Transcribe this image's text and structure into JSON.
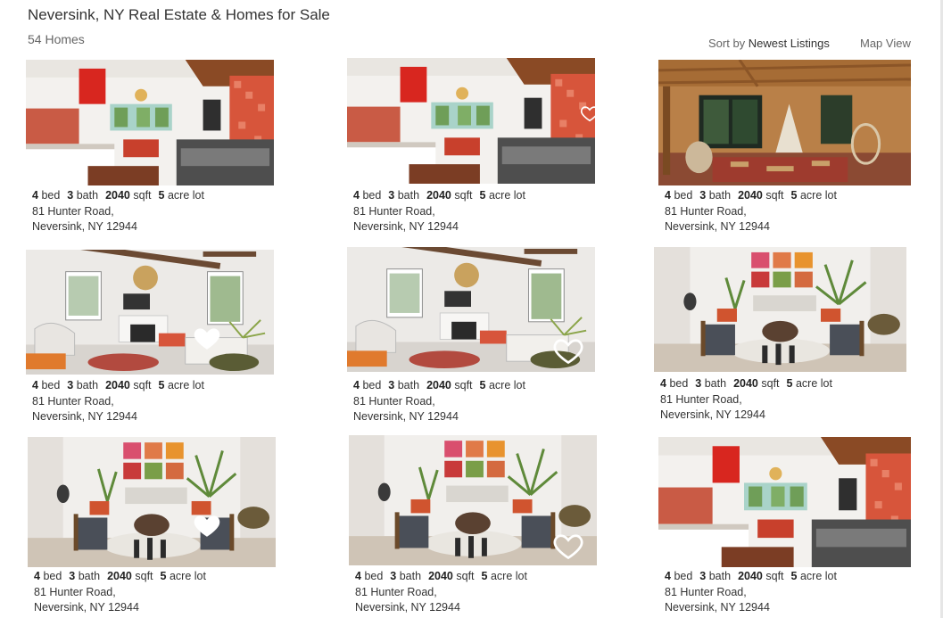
{
  "header": {
    "title": "Neversink, NY Real Estate & Homes for Sale",
    "count": "54 Homes",
    "sort_prefix": "Sort by ",
    "sort_value": "Newest Listings",
    "map_view": "Map View"
  },
  "listings": [
    {
      "beds": "4",
      "beds_unit": "bed",
      "baths": "3",
      "baths_unit": "bath",
      "sqft": "2040",
      "sqft_unit": "sqft",
      "lot": "5",
      "lot_unit": "acre lot",
      "address1": "81 Hunter Road,",
      "address2": "Neversink, NY 12944",
      "photo": "kitchen",
      "heart": "none"
    },
    {
      "beds": "4",
      "beds_unit": "bed",
      "baths": "3",
      "baths_unit": "bath",
      "sqft": "2040",
      "sqft_unit": "sqft",
      "lot": "5",
      "lot_unit": "acre lot",
      "address1": "81 Hunter Road,",
      "address2": "Neversink, NY 12944",
      "photo": "kitchen",
      "heart": "partial"
    },
    {
      "beds": "4",
      "beds_unit": "bed",
      "baths": "3",
      "baths_unit": "bath",
      "sqft": "2040",
      "sqft_unit": "sqft",
      "lot": "5",
      "lot_unit": "acre lot",
      "address1": "81 Hunter Road,",
      "address2": "Neversink, NY 12944",
      "photo": "wood-porch",
      "heart": "none"
    },
    {
      "beds": "4",
      "beds_unit": "bed",
      "baths": "3",
      "baths_unit": "bath",
      "sqft": "2040",
      "sqft_unit": "sqft",
      "lot": "5",
      "lot_unit": "acre lot",
      "address1": "81 Hunter Road,",
      "address2": "Neversink, NY 12944",
      "photo": "living-room",
      "heart": "filled"
    },
    {
      "beds": "4",
      "beds_unit": "bed",
      "baths": "3",
      "baths_unit": "bath",
      "sqft": "2040",
      "sqft_unit": "sqft",
      "lot": "5",
      "lot_unit": "acre lot",
      "address1": "81 Hunter Road,",
      "address2": "Neversink, NY 12944",
      "photo": "living-room",
      "heart": "outline"
    },
    {
      "beds": "4",
      "beds_unit": "bed",
      "baths": "3",
      "baths_unit": "bath",
      "sqft": "2040",
      "sqft_unit": "sqft",
      "lot": "5",
      "lot_unit": "acre lot",
      "address1": "81 Hunter Road,",
      "address2": "Neversink, NY 12944",
      "photo": "lounge",
      "heart": "none"
    },
    {
      "beds": "4",
      "beds_unit": "bed",
      "baths": "3",
      "baths_unit": "bath",
      "sqft": "2040",
      "sqft_unit": "sqft",
      "lot": "5",
      "lot_unit": "acre lot",
      "address1": "81 Hunter Road,",
      "address2": "Neversink, NY 12944",
      "photo": "lounge",
      "heart": "filled"
    },
    {
      "beds": "4",
      "beds_unit": "bed",
      "baths": "3",
      "baths_unit": "bath",
      "sqft": "2040",
      "sqft_unit": "sqft",
      "lot": "5",
      "lot_unit": "acre lot",
      "address1": "81 Hunter Road,",
      "address2": "Neversink, NY 12944",
      "photo": "lounge",
      "heart": "outline"
    },
    {
      "beds": "4",
      "beds_unit": "bed",
      "baths": "3",
      "baths_unit": "bath",
      "sqft": "2040",
      "sqft_unit": "sqft",
      "lot": "5",
      "lot_unit": "acre lot",
      "address1": "81 Hunter Road,",
      "address2": "Neversink, NY 12944",
      "photo": "kitchen",
      "heart": "none"
    }
  ]
}
